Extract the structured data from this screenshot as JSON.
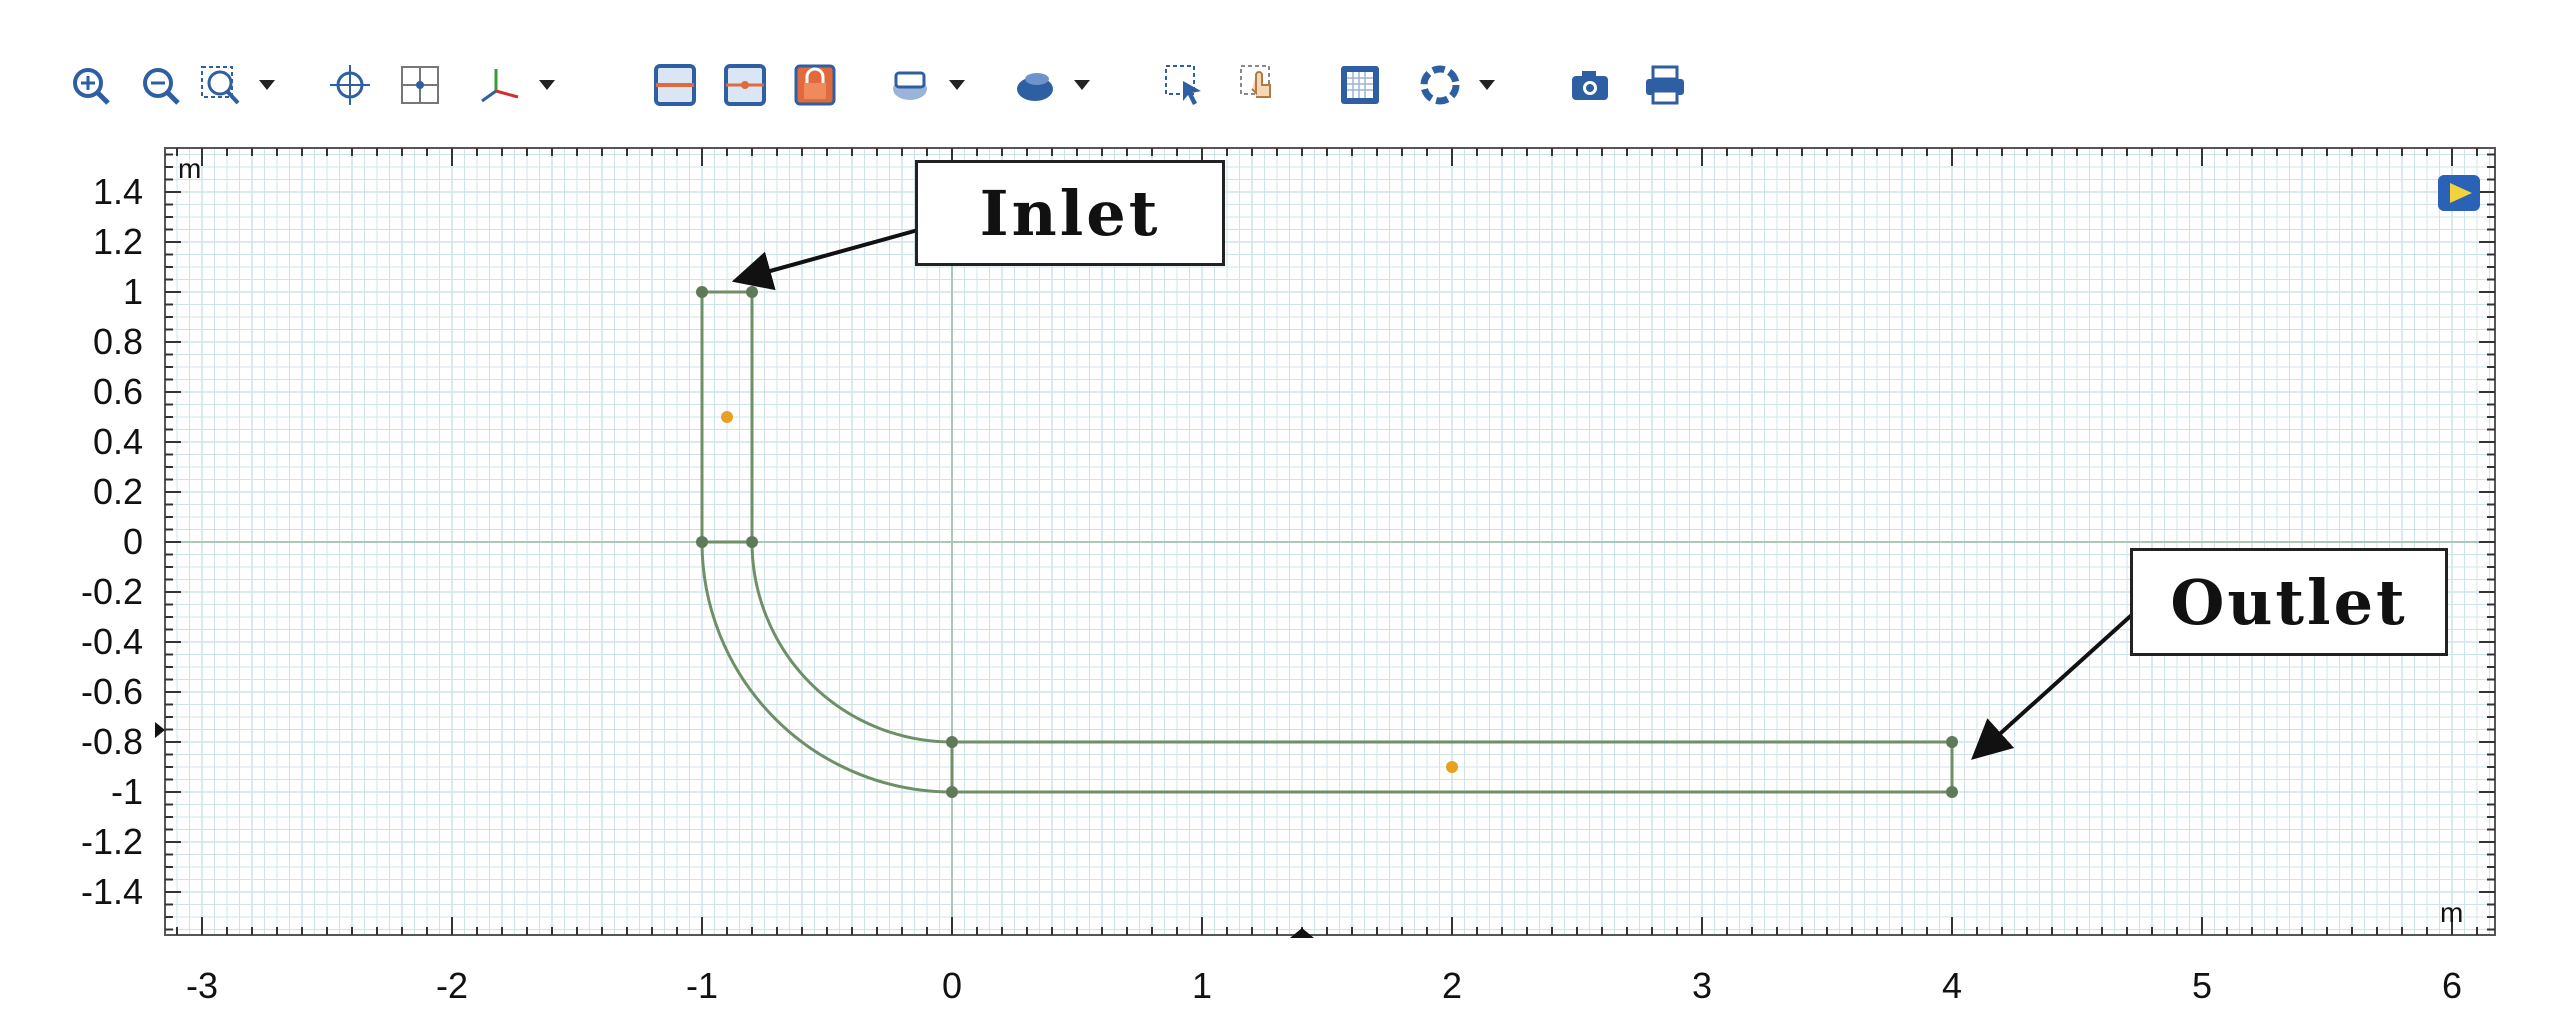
{
  "toolbar": {
    "buttons": [
      {
        "name": "zoom-in-icon"
      },
      {
        "name": "zoom-out-icon"
      },
      {
        "name": "zoom-box-icon",
        "has_dropdown": true
      },
      {
        "name": "zoom-extents-icon"
      },
      {
        "name": "zoom-to-selection-icon"
      },
      {
        "name": "axis-orientation-icon",
        "has_dropdown": true
      },
      {
        "name": "show-grid-icon"
      },
      {
        "name": "show-axis-icon"
      },
      {
        "name": "lock-icon"
      },
      {
        "name": "layer-display-icon",
        "has_dropdown": true
      },
      {
        "name": "render-icon",
        "has_dropdown": true
      },
      {
        "name": "select-box-icon"
      },
      {
        "name": "select-click-icon"
      },
      {
        "name": "select-all-icon"
      },
      {
        "name": "view-settings-icon",
        "has_dropdown": true
      },
      {
        "name": "camera-icon"
      },
      {
        "name": "print-icon"
      }
    ],
    "colors": {
      "icon": "#2e5fa3",
      "accent": "#e06a3b"
    }
  },
  "plot": {
    "unit_y": "m",
    "unit_x": "m",
    "x_ticks": [
      "-3",
      "-2",
      "-1",
      "0",
      "1",
      "2",
      "3",
      "4",
      "5",
      "6"
    ],
    "y_ticks": [
      "1.4",
      "1.2",
      "1",
      "0.8",
      "0.6",
      "0.4",
      "0.2",
      "0",
      "-0.2",
      "-0.4",
      "-0.6",
      "-0.8",
      "-1",
      "-1.2",
      "-1.4"
    ],
    "xlim": [
      -3.1,
      6.1
    ],
    "ylim": [
      -1.55,
      1.55
    ],
    "grid": true,
    "colors": {
      "grid": "#cfe4ea",
      "geometry": "#6f8f67",
      "point": "#e8a020"
    }
  },
  "geometry": {
    "inlet_pipe": {
      "x": [
        -1,
        -0.8
      ],
      "y": [
        0,
        1
      ]
    },
    "elbow_center": [
      0,
      0
    ],
    "elbow_radii": [
      0.8,
      1
    ],
    "outlet_pipe": {
      "x": [
        0,
        4
      ],
      "y": [
        -1,
        -0.8
      ]
    },
    "vertices": [
      [
        -1,
        1
      ],
      [
        -0.8,
        1
      ],
      [
        -1,
        0
      ],
      [
        -0.8,
        0
      ],
      [
        0,
        -0.8
      ],
      [
        0,
        -1
      ],
      [
        4,
        -0.8
      ],
      [
        4,
        -1
      ]
    ],
    "markers": [
      [
        -0.9,
        0.5
      ],
      [
        2,
        -0.9
      ]
    ]
  },
  "annotations": {
    "inlet_label": "Inlet",
    "outlet_label": "Outlet",
    "inlet_target": [
      -0.85,
      1.05
    ],
    "outlet_target": [
      4.1,
      -0.85
    ]
  }
}
